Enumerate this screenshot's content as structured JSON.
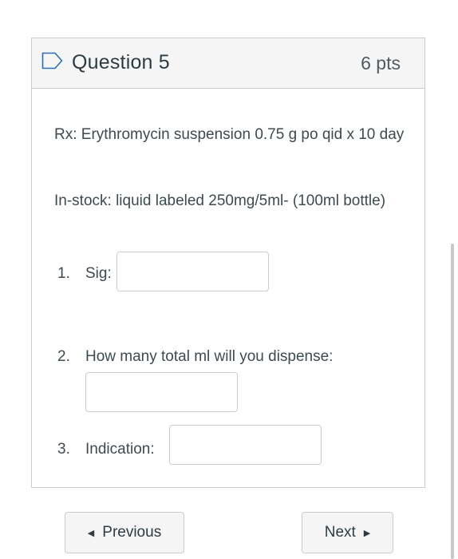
{
  "question": {
    "title": "Question 5",
    "points": "6 pts",
    "prompt_rx": "Rx: Erythromycin suspension 0.75 g po qid x 10 day",
    "prompt_stock": "In-stock: liquid labeled 250mg/5ml- (100ml bottle)",
    "items": [
      {
        "number": "1.",
        "label": "Sig:",
        "value": ""
      },
      {
        "number": "2.",
        "label": "How many total ml will you dispense:",
        "value": ""
      },
      {
        "number": "3.",
        "label": "Indication:",
        "value": ""
      }
    ]
  },
  "navigation": {
    "previous_label": "Previous",
    "next_label": "Next"
  },
  "icons": {
    "flag": "flag-icon",
    "prev": "caret-left-icon",
    "next": "caret-right-icon"
  },
  "colors": {
    "border": "#c7cdd1",
    "header_bg": "#f5f5f5",
    "text": "#2d3b45"
  }
}
